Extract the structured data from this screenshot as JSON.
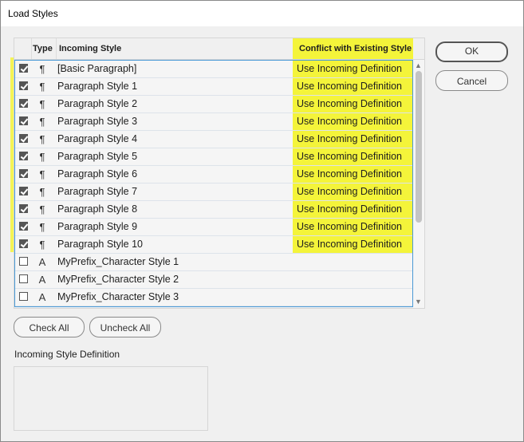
{
  "window": {
    "title": "Load Styles"
  },
  "table": {
    "headers": {
      "type": "Type",
      "incoming": "Incoming Style",
      "conflict": "Conflict with Existing Style"
    },
    "rows": [
      {
        "checked": true,
        "type_icon": "paragraph-icon",
        "type_glyph": "¶",
        "name": "[Basic Paragraph]",
        "conflict": "Use Incoming Definition"
      },
      {
        "checked": true,
        "type_icon": "paragraph-icon",
        "type_glyph": "¶",
        "name": "Paragraph Style 1",
        "conflict": "Use Incoming Definition"
      },
      {
        "checked": true,
        "type_icon": "paragraph-icon",
        "type_glyph": "¶",
        "name": "Paragraph Style 2",
        "conflict": "Use Incoming Definition"
      },
      {
        "checked": true,
        "type_icon": "paragraph-icon",
        "type_glyph": "¶",
        "name": "Paragraph Style 3",
        "conflict": "Use Incoming Definition"
      },
      {
        "checked": true,
        "type_icon": "paragraph-icon",
        "type_glyph": "¶",
        "name": "Paragraph Style 4",
        "conflict": "Use Incoming Definition"
      },
      {
        "checked": true,
        "type_icon": "paragraph-icon",
        "type_glyph": "¶",
        "name": "Paragraph Style 5",
        "conflict": "Use Incoming Definition"
      },
      {
        "checked": true,
        "type_icon": "paragraph-icon",
        "type_glyph": "¶",
        "name": "Paragraph Style 6",
        "conflict": "Use Incoming Definition"
      },
      {
        "checked": true,
        "type_icon": "paragraph-icon",
        "type_glyph": "¶",
        "name": "Paragraph Style 7",
        "conflict": "Use Incoming Definition"
      },
      {
        "checked": true,
        "type_icon": "paragraph-icon",
        "type_glyph": "¶",
        "name": "Paragraph Style 8",
        "conflict": "Use Incoming Definition"
      },
      {
        "checked": true,
        "type_icon": "paragraph-icon",
        "type_glyph": "¶",
        "name": "Paragraph Style 9",
        "conflict": "Use Incoming Definition"
      },
      {
        "checked": true,
        "type_icon": "paragraph-icon",
        "type_glyph": "¶",
        "name": "Paragraph Style 10",
        "conflict": "Use Incoming Definition"
      },
      {
        "checked": false,
        "type_icon": "character-icon",
        "type_glyph": "A",
        "name": "MyPrefix_Character Style 1",
        "conflict": ""
      },
      {
        "checked": false,
        "type_icon": "character-icon",
        "type_glyph": "A",
        "name": "MyPrefix_Character Style 2",
        "conflict": ""
      },
      {
        "checked": false,
        "type_icon": "character-icon",
        "type_glyph": "A",
        "name": "MyPrefix_Character Style 3",
        "conflict": ""
      }
    ]
  },
  "buttons": {
    "ok": "OK",
    "cancel": "Cancel",
    "check_all": "Check All",
    "uncheck_all": "Uncheck All"
  },
  "definition": {
    "label": "Incoming Style Definition"
  },
  "colors": {
    "highlight": "#f4f43a",
    "selection_border": "#4a9ad6"
  }
}
